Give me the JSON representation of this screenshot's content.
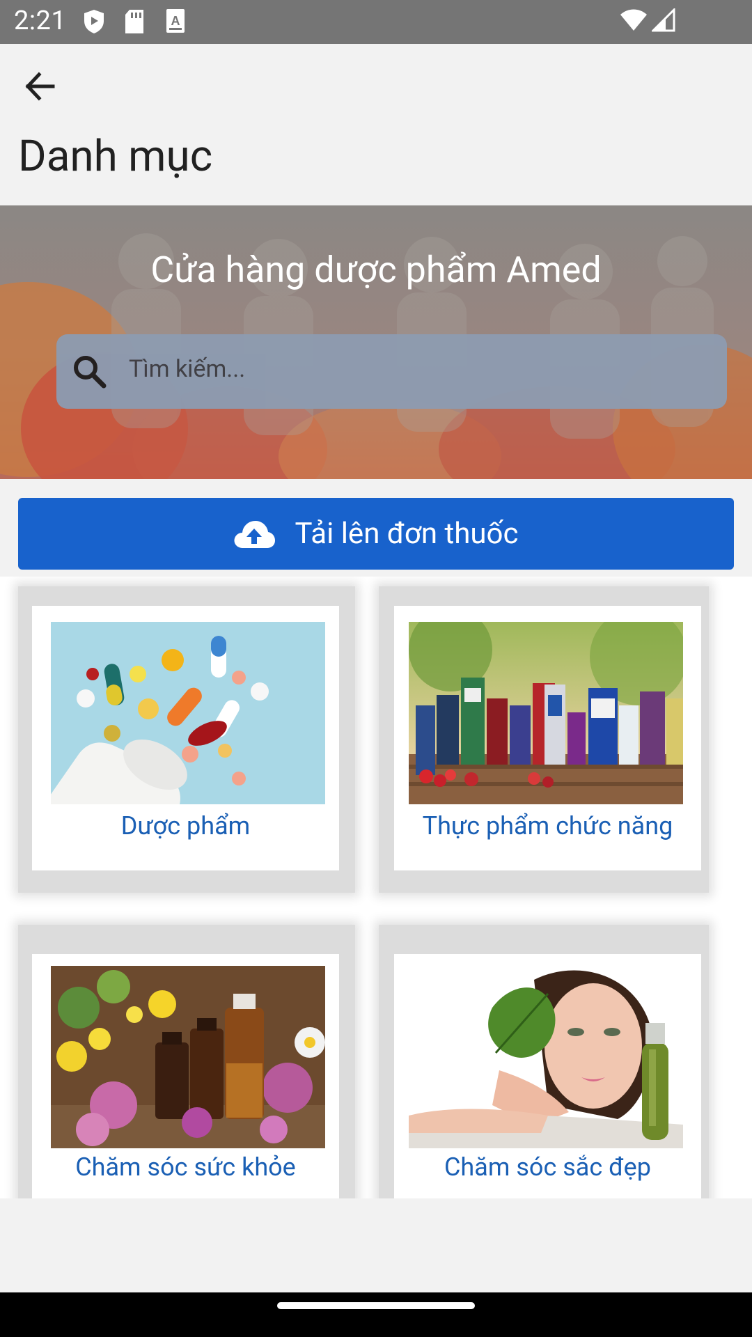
{
  "status_bar": {
    "time": "2:21",
    "icons": [
      "shield-icon",
      "sd-card-icon",
      "text-a-icon",
      "wifi-icon",
      "signal-icon"
    ]
  },
  "app_bar": {
    "back_icon": "arrow-back-icon",
    "title": "Danh mục"
  },
  "hero": {
    "title": "Cửa hàng dược phẩm Amed",
    "search_placeholder": "Tìm kiếm..."
  },
  "upload": {
    "label": "Tải lên đơn thuốc",
    "icon": "cloud-upload-icon"
  },
  "categories": [
    {
      "label": "Dược phẩm"
    },
    {
      "label": "Thực phẩm chức năng"
    },
    {
      "label": "Chăm sóc sức khỏe"
    },
    {
      "label": "Chăm sóc sắc đẹp"
    }
  ],
  "colors": {
    "primary": "#1862cc",
    "category_text": "#1a5fb4",
    "status_bar": "#757575"
  }
}
